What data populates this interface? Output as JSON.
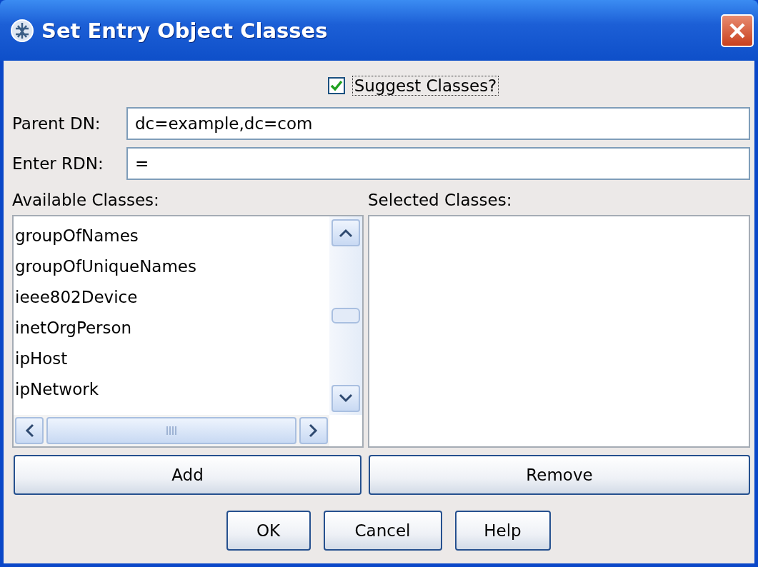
{
  "window": {
    "title": "Set Entry Object Classes"
  },
  "suggest": {
    "label": "Suggest Classes?",
    "checked": true
  },
  "fields": [
    {
      "label": "Parent DN:",
      "value": "dc=example,dc=com"
    },
    {
      "label": "Enter RDN:",
      "value": "="
    }
  ],
  "available": {
    "label": "Available Classes:",
    "items": [
      "groupOfNames",
      "groupOfUniqueNames",
      "ieee802Device",
      "inetOrgPerson",
      "ipHost",
      "ipNetwork"
    ]
  },
  "selected": {
    "label": "Selected Classes:"
  },
  "list_buttons": [
    "Add",
    "Remove"
  ],
  "buttons": [
    "OK",
    "Cancel",
    "Help"
  ]
}
